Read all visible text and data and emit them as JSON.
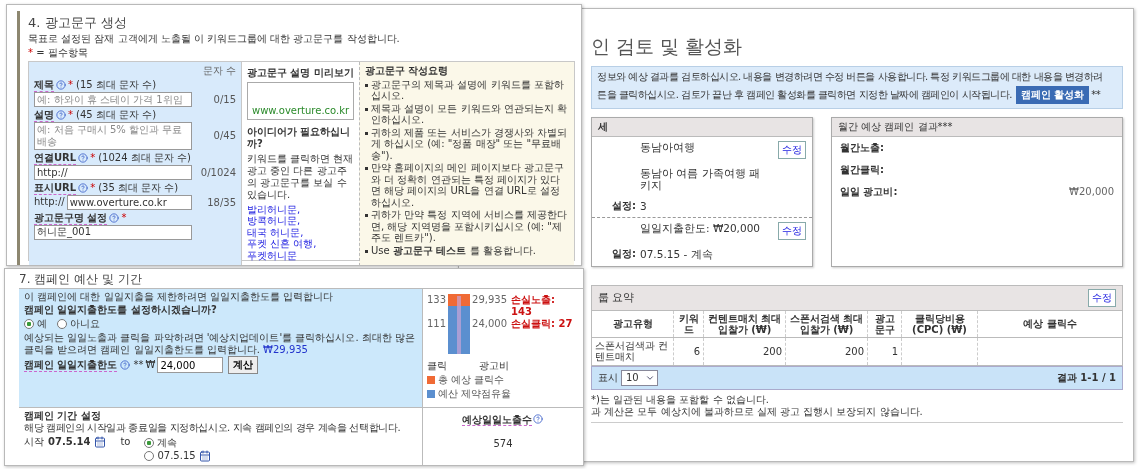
{
  "ad_copy_panel": {
    "title": "4. 광고문구 생성",
    "description": "목표로 설정된 잠재 고객에게 노출될 이 키워드그룹에 대한 광고문구를 작성합니다.",
    "required_mark": "*",
    "required_note": "= 필수항목",
    "count_header": "문자 수",
    "fields": [
      {
        "kind": "input",
        "label": "제목",
        "required": true,
        "hint": "(15 최대 문자 수)",
        "placeholder": "예: 하와이 휴 스테이 가격 1위임",
        "count": "0/15"
      },
      {
        "kind": "textarea",
        "label": "설명",
        "required": true,
        "hint": "(45 최대 문자 수)",
        "placeholder": "예: 처음 구매시 5% 할인과 무료배송",
        "count": "0/45"
      },
      {
        "kind": "input",
        "label": "연결URL",
        "required": true,
        "hint": "(1024 최대 문자 수)",
        "value": "http://",
        "count": "0/1024"
      },
      {
        "kind": "prefixed",
        "label": "표시URL",
        "required": true,
        "hint": "(35 최대 문자 수)",
        "prefix": "http://",
        "value": "www.overture.co.kr",
        "count": "18/35"
      },
      {
        "kind": "input",
        "label": "광고문구명 설정",
        "required": true,
        "value": "허니문_001"
      }
    ],
    "preview": {
      "title": "광고문구 설명 미리보기",
      "url": "www.overture.co.kr"
    },
    "tips": {
      "title": "광고문구 작성요령",
      "items": [
        "광고문구의 제목과 설명에 키워드를 포함하십시오.",
        "제목과 설명이 모든 키워드와 연관되는지 확인하십시오.",
        "귀하의 제품 또는 서비스가 경쟁사와 차별되게 하십시오 (예: \"정품 매장\" 또는 \"무료배송\").",
        "만약 홈페이지의 메인 페이지보다 광고문구와 더 정확히 연관되는 특정 페이지가 있다면 해당 페이지의 URL을 연결 URL로 설정하십시오.",
        "귀하가 만약 특정 지역에 서비스를 제공한다면, 해당 지역명을 포함시키십시오 (예: \"제주도 렌트카\").",
        "Use **광고문구 테스트** 를 활용합니다."
      ]
    },
    "idea": {
      "title": "아이디어가 필요하십니까?",
      "text": "키워드를 클릭하면 현재 광고 중인 다른 광고주의 광고문구를 보실 수 있습니다.",
      "links": [
        "발리허니문,",
        "방콕허니문,",
        "태국 허니문,",
        "푸켓 신혼 여행,",
        "푸켓허니문"
      ]
    }
  },
  "review_panel": {
    "title": "인 검토 및 활성화",
    "info": [
      "정보와 예상 결과를 검토하십시오. 내용을 변경하려면 수정 버튼을 사용합니다. 특정 키워드그룹에 대한 내용을 변경하려",
      "튼을 클릭하십시오. 검토가 끝난 후 캠페인 활성화를 클릭하면 지정한 날짜에 캠페인이 시작됩니다."
    ],
    "activate_button": "캠페인 활성화",
    "activate_mark": "**",
    "details": {
      "title": "세",
      "rows": [
        {
          "value": "동남아여행",
          "edit": "수정"
        },
        {
          "value": "동남아 여름 가족여행 패키지"
        },
        {
          "label": "설정:",
          "value": "3"
        },
        {
          "value": "일일지출한도: ₩20,000",
          "edit": "수정"
        },
        {
          "label": "일정:",
          "value": "07.5.15 - 계속"
        }
      ]
    },
    "results": {
      "title": "월간 예상 캠페인 결과***",
      "rows": [
        {
          "label": "월간노출:"
        },
        {
          "label": "월간클릭:"
        },
        {
          "label": "일일 광고비:",
          "value": "₩20,000"
        }
      ]
    },
    "summary": {
      "title": "룹 요약",
      "edit": "수정",
      "columns": [
        "광고유형",
        "키워드",
        "컨텐트매치 최대입찰가 (₩)",
        "스폰서검색 최대입찰가 (₩)",
        "광고문구",
        "클릭당비용 (CPC) (₩)",
        "예상 클릭수"
      ],
      "rows": [
        [
          "스폰서검색과 컨텐트매치",
          "6",
          "200",
          "200",
          "1",
          null,
          null
        ]
      ],
      "page_size_label": "표시",
      "page_size": "10",
      "result_count": "결과 1-1 / 1"
    },
    "notes": [
      "*)는 일관된 내용을 포함할 수 없습니다.",
      "과 계산은 모두 예상치에 불과하므로 실제 광고 집행시 보장되지 않습니다."
    ]
  },
  "budget_panel": {
    "title": "7. 캠페인 예산 및 기간",
    "intro": "이 캠페인에 대한 일일지출을 제한하려면 일일지출한도를 입력합니다",
    "question": "캠페인 일일지출한도를 설정하시겠습니까?",
    "options": [
      {
        "label": "예",
        "selected": true
      },
      {
        "label": "아니요",
        "selected": false
      }
    ],
    "note": "예상되는 일일노출과 클릭을 파악하려면 '예상치업데이트'를 클릭하십시오. 최대한 많은 클릭을 받으려면 캠페인 일일지출한도를 입력합니다.",
    "suggested_amount": "₩29,935",
    "budget_label": "캠페인 일일지출한도",
    "budget_mark": "**",
    "currency": "₩",
    "budget_value": "24,000",
    "calc_button": "계산",
    "chart": {
      "left_ticks": [
        "133",
        "111"
      ],
      "right_ticks": [
        "29,935",
        "24,000"
      ],
      "bottom_left": "클릭",
      "bottom_right": "광고비",
      "lost": [
        "손실노출: 143",
        "손실클릭: 27"
      ],
      "legend": [
        {
          "label": "총 예상 클릭수",
          "color": "#f06a35"
        },
        {
          "label": "예산 제약점유율",
          "color": "#5b8fcf"
        }
      ]
    },
    "period": {
      "title": "캠페인 기간 설정",
      "text": "해당 캠페인의 시작일과 종료일을 지정하십시오. 지속 캠페인의 경우 계속을 선택합니다.",
      "start_label": "시작",
      "start_date": "07.5.14",
      "to": "to",
      "end_options": [
        {
          "label": "계속",
          "selected": true
        },
        {
          "label": "07.5.15",
          "selected": false
        }
      ]
    },
    "estimate": {
      "title": "예상일일노출수",
      "value": "574"
    }
  }
}
